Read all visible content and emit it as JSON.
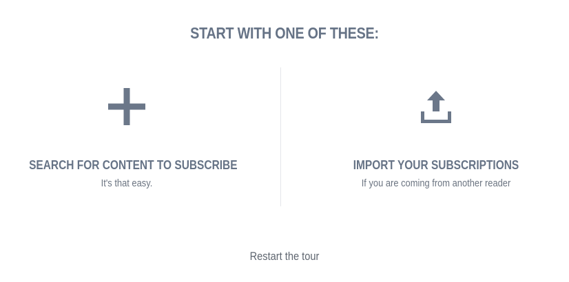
{
  "heading": "START WITH ONE OF THESE:",
  "options": [
    {
      "icon": "plus-icon",
      "title": "SEARCH FOR CONTENT TO SUBSCRIBE",
      "subtitle": "It's that easy."
    },
    {
      "icon": "upload-icon",
      "title": "IMPORT YOUR SUBSCRIPTIONS",
      "subtitle": "If you are coming from another reader"
    }
  ],
  "footer": {
    "restart_label": "Restart the tour"
  },
  "colors": {
    "heading": "#667386",
    "icon": "#6b7789",
    "divider": "#e4e6ea",
    "text": "#5f6670"
  }
}
